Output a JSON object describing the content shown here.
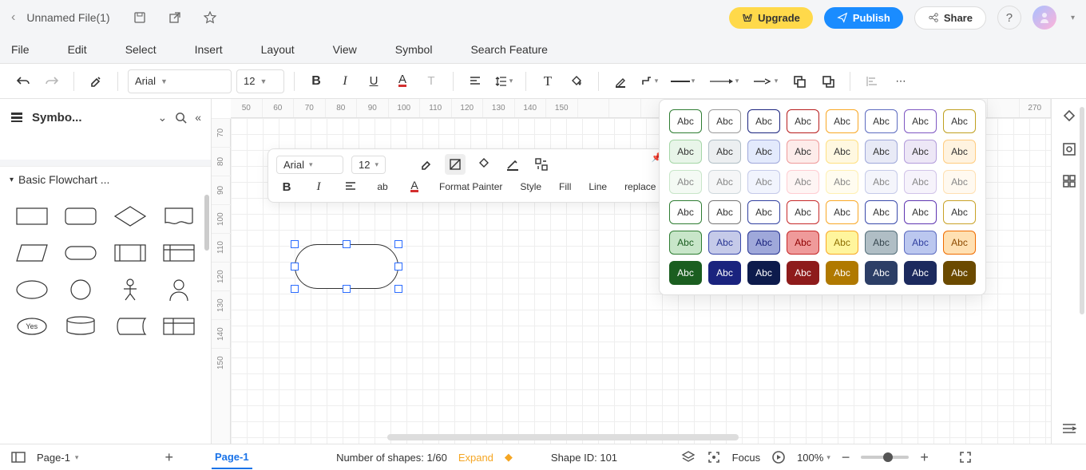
{
  "header": {
    "title": "Unnamed File(1)",
    "upgrade": "Upgrade",
    "publish": "Publish",
    "share": "Share"
  },
  "menu": [
    "File",
    "Edit",
    "Select",
    "Insert",
    "Layout",
    "View",
    "Symbol",
    "Search Feature"
  ],
  "toolbar": {
    "font": "Arial",
    "fontSize": "12"
  },
  "leftPanel": {
    "title": "Symbo...",
    "section": "Basic Flowchart ...",
    "yesLabel": "Yes"
  },
  "floatToolbar": {
    "font": "Arial",
    "fontSize": "12",
    "formatPainter": "Format Painter",
    "style": "Style",
    "fill": "Fill",
    "line": "Line",
    "replace": "replace"
  },
  "stylePopup": {
    "label": "Abc",
    "rows": [
      [
        {
          "bg": "#ffffff",
          "border": "#2e7d32",
          "fg": "#333"
        },
        {
          "bg": "#ffffff",
          "border": "#999999",
          "fg": "#333"
        },
        {
          "bg": "#ffffff",
          "border": "#1a237e",
          "fg": "#333"
        },
        {
          "bg": "#ffffff",
          "border": "#b71c1c",
          "fg": "#333"
        },
        {
          "bg": "#ffffff",
          "border": "#f9a825",
          "fg": "#333"
        },
        {
          "bg": "#ffffff",
          "border": "#5c6bc0",
          "fg": "#333"
        },
        {
          "bg": "#ffffff",
          "border": "#7e57c2",
          "fg": "#333"
        },
        {
          "bg": "#ffffff",
          "border": "#c0a020",
          "fg": "#333"
        }
      ],
      [
        {
          "bg": "#e8f5e9",
          "border": "#a5d6a7",
          "fg": "#333"
        },
        {
          "bg": "#eceff1",
          "border": "#b0bec5",
          "fg": "#333"
        },
        {
          "bg": "#e3eafc",
          "border": "#9fa8da",
          "fg": "#333"
        },
        {
          "bg": "#fdecea",
          "border": "#ef9a9a",
          "fg": "#333"
        },
        {
          "bg": "#fff8e1",
          "border": "#ffe082",
          "fg": "#333"
        },
        {
          "bg": "#e8eaf6",
          "border": "#9fa8da",
          "fg": "#333"
        },
        {
          "bg": "#ede7f6",
          "border": "#b39ddb",
          "fg": "#333"
        },
        {
          "bg": "#fff3e0",
          "border": "#ffcc80",
          "fg": "#333"
        }
      ],
      [
        {
          "bg": "#f4faf4",
          "border": "#c8e6c9",
          "fg": "#888"
        },
        {
          "bg": "#f5f6f7",
          "border": "#cfd8dc",
          "fg": "#888"
        },
        {
          "bg": "#f1f4fd",
          "border": "#c5cae9",
          "fg": "#888"
        },
        {
          "bg": "#fef5f4",
          "border": "#ffcdd2",
          "fg": "#888"
        },
        {
          "bg": "#fffcf0",
          "border": "#fff0b3",
          "fg": "#888"
        },
        {
          "bg": "#f4f5fb",
          "border": "#c5cae9",
          "fg": "#888"
        },
        {
          "bg": "#f6f3fb",
          "border": "#d1c4e9",
          "fg": "#888"
        },
        {
          "bg": "#fff9f0",
          "border": "#ffe0b2",
          "fg": "#888"
        }
      ],
      [
        {
          "bg": "#ffffff",
          "border": "#2e7d32",
          "fg": "#333"
        },
        {
          "bg": "#ffffff",
          "border": "#757575",
          "fg": "#333"
        },
        {
          "bg": "#ffffff",
          "border": "#303f9f",
          "fg": "#333"
        },
        {
          "bg": "#ffffff",
          "border": "#c62828",
          "fg": "#333"
        },
        {
          "bg": "#ffffff",
          "border": "#f9a825",
          "fg": "#333"
        },
        {
          "bg": "#ffffff",
          "border": "#3949ab",
          "fg": "#333"
        },
        {
          "bg": "#ffffff",
          "border": "#5e35b1",
          "fg": "#333"
        },
        {
          "bg": "#ffffff",
          "border": "#c9a227",
          "fg": "#333"
        }
      ],
      [
        {
          "bg": "#c8e6c9",
          "border": "#2e7d32",
          "fg": "#1b5e20"
        },
        {
          "bg": "#c5cae9",
          "border": "#3949ab",
          "fg": "#283593"
        },
        {
          "bg": "#9fa8da",
          "border": "#283593",
          "fg": "#1a237e"
        },
        {
          "bg": "#ef9a9a",
          "border": "#c62828",
          "fg": "#8e0000"
        },
        {
          "bg": "#fff59d",
          "border": "#f9a825",
          "fg": "#8d6e00"
        },
        {
          "bg": "#b0bec5",
          "border": "#546e7a",
          "fg": "#37474f"
        },
        {
          "bg": "#bbc7ef",
          "border": "#5c6bc0",
          "fg": "#303f9f"
        },
        {
          "bg": "#ffe0b2",
          "border": "#ef6c00",
          "fg": "#8d4b00"
        }
      ],
      [
        {
          "bg": "#1b5e20",
          "fg": "#fff",
          "dark": true
        },
        {
          "bg": "#1a237e",
          "fg": "#fff",
          "dark": true
        },
        {
          "bg": "#0d1b4c",
          "fg": "#fff",
          "dark": true
        },
        {
          "bg": "#8e1b1b",
          "fg": "#fff",
          "dark": true
        },
        {
          "bg": "#b07900",
          "fg": "#fff",
          "dark": true
        },
        {
          "bg": "#2c3e66",
          "fg": "#fff",
          "dark": true
        },
        {
          "bg": "#1c2a5e",
          "fg": "#fff",
          "dark": true
        },
        {
          "bg": "#6b4a00",
          "fg": "#fff",
          "dark": true
        }
      ]
    ]
  },
  "rulerH": [
    "50",
    "60",
    "70",
    "80",
    "90",
    "100",
    "110",
    "120",
    "130",
    "140",
    "150",
    "",
    "",
    "",
    "",
    "",
    "",
    "",
    "",
    "",
    "",
    "",
    "",
    "",
    "",
    "270"
  ],
  "rulerV": [
    "70",
    "80",
    "90",
    "100",
    "110",
    "120",
    "130",
    "140",
    "150"
  ],
  "status": {
    "pageSelect": "Page-1",
    "pageTab": "Page-1",
    "shapesCount": "Number of shapes: 1/60",
    "expand": "Expand",
    "shapeId": "Shape ID: 101",
    "focus": "Focus",
    "zoom": "100%"
  }
}
